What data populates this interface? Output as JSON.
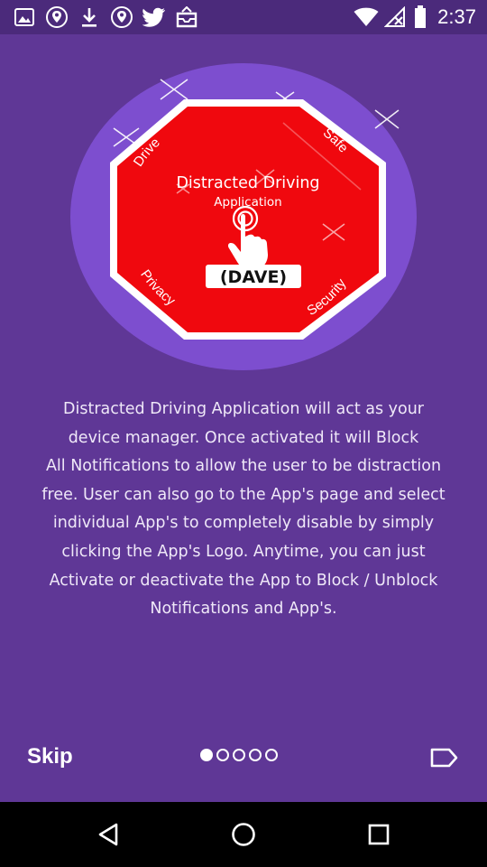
{
  "status_bar": {
    "time": "2:37",
    "left_icons": [
      "image-icon",
      "location-shield-icon",
      "download-icon",
      "location-shield-icon",
      "twitter-bird-icon",
      "inbox-icon"
    ],
    "right_icons": [
      "wifi-icon",
      "no-signal-icon",
      "battery-icon"
    ]
  },
  "logo": {
    "title_line1": "Distracted Driving",
    "title_line2": "Application",
    "badge": "(DAVE)",
    "corner_top_left": "Drive",
    "corner_top_right": "Safe",
    "corner_bottom_left": "Privacy",
    "corner_bottom_right": "Security"
  },
  "description": {
    "lines": [
      "Distracted Driving Application will act as your",
      "device manager. Once activated it will Block",
      "All Notifications to allow the user to be distraction",
      "free. User can also go to the App's page and select",
      "individual  App's to completely disable by simply",
      "clicking the App's Logo. Anytime, you can just",
      "Activate or deactivate the App to Block / Unblock",
      "Notifications and App's."
    ]
  },
  "footer": {
    "skip_label": "Skip",
    "page_count": 5,
    "current_page": 1
  },
  "colors": {
    "background": "#5f3796",
    "status_bar": "#4b2a7b",
    "circle": "#7d4ecf",
    "stop_sign": "#f0080e",
    "nav_bar": "#000000"
  }
}
